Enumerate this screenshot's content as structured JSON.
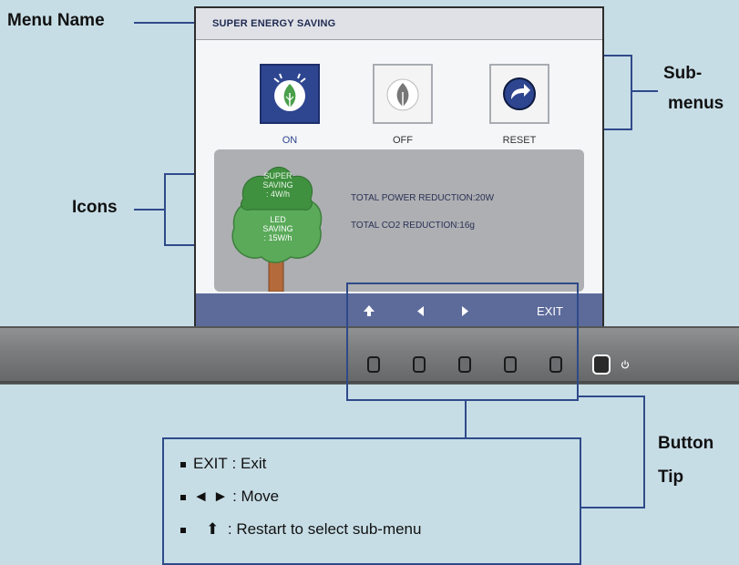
{
  "callouts": {
    "menu_name": "Menu Name",
    "icons": "Icons",
    "submenus_line1": "Sub-",
    "submenus_line2": "menus",
    "button_tip_line1": "Button",
    "button_tip_line2": "Tip"
  },
  "osd": {
    "title": "SUPER ENERGY SAVING",
    "options": [
      {
        "label": "ON",
        "icon": "leaf-on-icon",
        "selected": true
      },
      {
        "label": "OFF",
        "icon": "leaf-off-icon",
        "selected": false
      },
      {
        "label": "RESET",
        "icon": "reset-arrow-icon",
        "selected": false
      }
    ],
    "tree": {
      "super_line1": "SUPER",
      "super_line2": "SAVING",
      "super_line3": ": 4W/h",
      "led_line1": "LED",
      "led_line2": "SAVING",
      "led_line3": ": 15W/h"
    },
    "info": {
      "power_reduction": "TOTAL POWER REDUCTION:20W",
      "co2_reduction": "TOTAL CO2 REDUCTION:16g"
    },
    "footer": {
      "up_icon": "up-arrow-icon",
      "left_icon": "left-arrow-icon",
      "right_icon": "right-arrow-icon",
      "exit_label": "EXIT"
    }
  },
  "tips": [
    {
      "key": "EXIT",
      "desc": ": Exit"
    },
    {
      "key": "◄ ►",
      "desc": ": Move"
    },
    {
      "key": "⬆",
      "desc": ": Restart to select sub-menu"
    }
  ],
  "colors": {
    "background": "#c7dde6",
    "osd_selected": "#2e4590",
    "osd_footer": "#5d6b9b",
    "leader_lines": "#2f4a8a",
    "tree_green": "#5aaa5a"
  }
}
